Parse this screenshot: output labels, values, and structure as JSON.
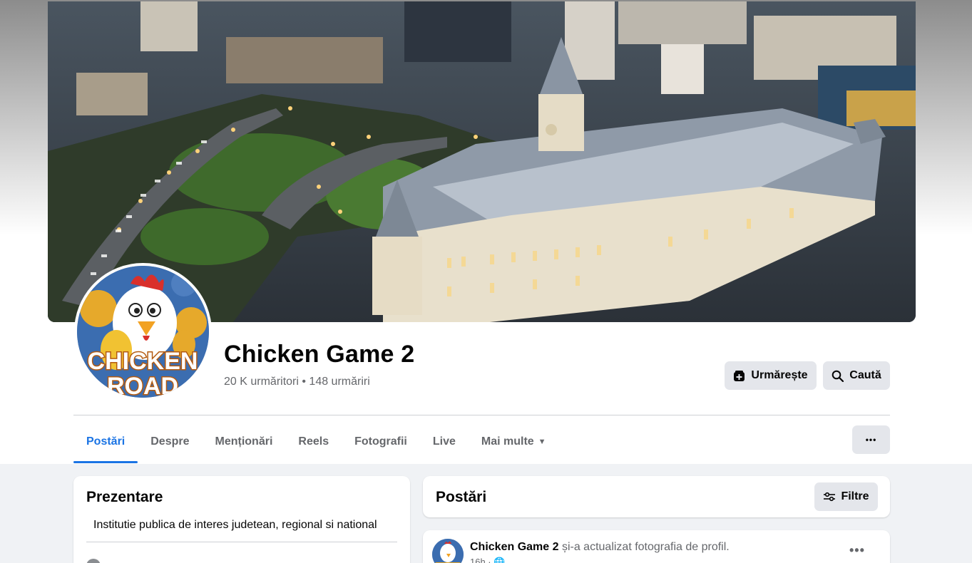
{
  "page": {
    "name": "Chicken Game 2",
    "stats": "20 K urmăritori • 148 urmăriri",
    "avatar_logo": "CHICKEN ROAD"
  },
  "actions": {
    "follow_label": "Urmărește",
    "search_label": "Caută",
    "more_label": "•••"
  },
  "tabs": [
    {
      "label": "Postări",
      "active": true
    },
    {
      "label": "Despre"
    },
    {
      "label": "Menționări"
    },
    {
      "label": "Reels"
    },
    {
      "label": "Fotografii"
    },
    {
      "label": "Live"
    },
    {
      "label": "Mai multe",
      "dropdown": true
    }
  ],
  "intro": {
    "title": "Prezentare",
    "description": "Institutie publica de interes judetean, regional si national"
  },
  "posts_section": {
    "title": "Postări",
    "filter_label": "Filtre"
  },
  "post": {
    "author": "Chicken Game 2",
    "action_text": " și-a actualizat fotografia de profil.",
    "time": "16h · 🌐",
    "more_label": "•••"
  },
  "colors": {
    "accent": "#1b74e4",
    "button_bg": "#e4e6eb",
    "feed_bg": "#f0f2f5"
  }
}
